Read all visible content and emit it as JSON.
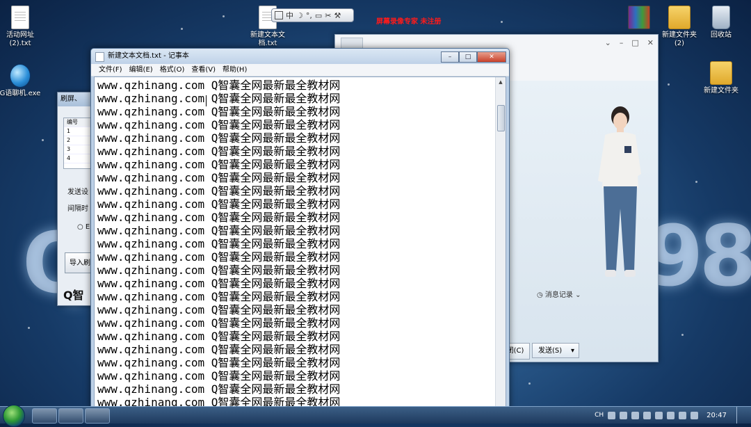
{
  "desktop": {
    "icons": [
      {
        "label": "活动网址\n(2).txt",
        "icon": "text-file-icon"
      },
      {
        "label": "G语聊机.exe",
        "icon": "globe-app-icon"
      },
      {
        "label": "新建文本文\n档.txt",
        "icon": "text-file-icon"
      },
      {
        "label": "新建文件夹\n(2)",
        "icon": "folder-icon"
      },
      {
        "label": "回收站",
        "icon": "recycle-bin-icon"
      },
      {
        "label": "新建文件夹",
        "icon": "folder-icon"
      }
    ],
    "watermark": "屏幕录像专家  未注册",
    "deco_left": "Q",
    "deco_right": "98"
  },
  "ime": {
    "mode": "中"
  },
  "left_window": {
    "title": "刷屏、",
    "column_header": "编号",
    "rows": [
      "1",
      "2",
      "3",
      "4"
    ],
    "send_label": "发送设",
    "interval_label": "间隔时",
    "radio_label": "E",
    "import_button": "导入刷",
    "footer": "Q智"
  },
  "chat_window": {
    "history_label": "消息记录",
    "close_button": "闭(C)",
    "send_button": "发送(S)"
  },
  "notepad": {
    "title": "新建文本文档.txt - 记事本",
    "menu": [
      "文件(F)",
      "编辑(E)",
      "格式(O)",
      "查看(V)",
      "帮助(H)"
    ],
    "line_text": "www.qzhinang.com Q智囊全网最新最全教材网",
    "line_count": 25,
    "buttons": {
      "minimize": "–",
      "maximize": "□",
      "close": "✕"
    }
  },
  "taskbar": {
    "tray": {
      "lang": "CH",
      "time": "20:47"
    }
  }
}
